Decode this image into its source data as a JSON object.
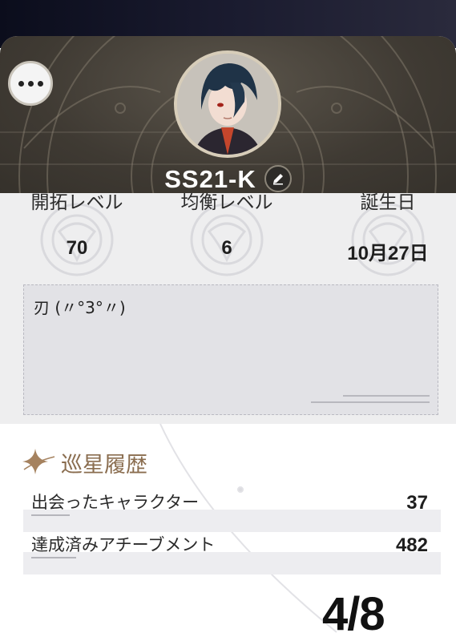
{
  "profile": {
    "username": "SS21-K",
    "more_icon": "more-horizontal-icon",
    "edit_icon": "pencil-icon"
  },
  "stats": [
    {
      "label": "開拓レベル",
      "value": "70"
    },
    {
      "label": "均衡レベル",
      "value": "6"
    },
    {
      "label": "誕生日",
      "value": "10月27日"
    }
  ],
  "signature": {
    "text": "刃 (〃°3°〃)"
  },
  "section": {
    "title": "巡星履歴",
    "rows": [
      {
        "label": "出会ったキャラクター",
        "value": "37"
      },
      {
        "label": "達成済みアチーブメント",
        "value": "482"
      }
    ]
  },
  "page_indicator": "4/8",
  "colors": {
    "header": "#3f3a33",
    "card": "#eeeeef",
    "accent": "#8a6d4f"
  }
}
